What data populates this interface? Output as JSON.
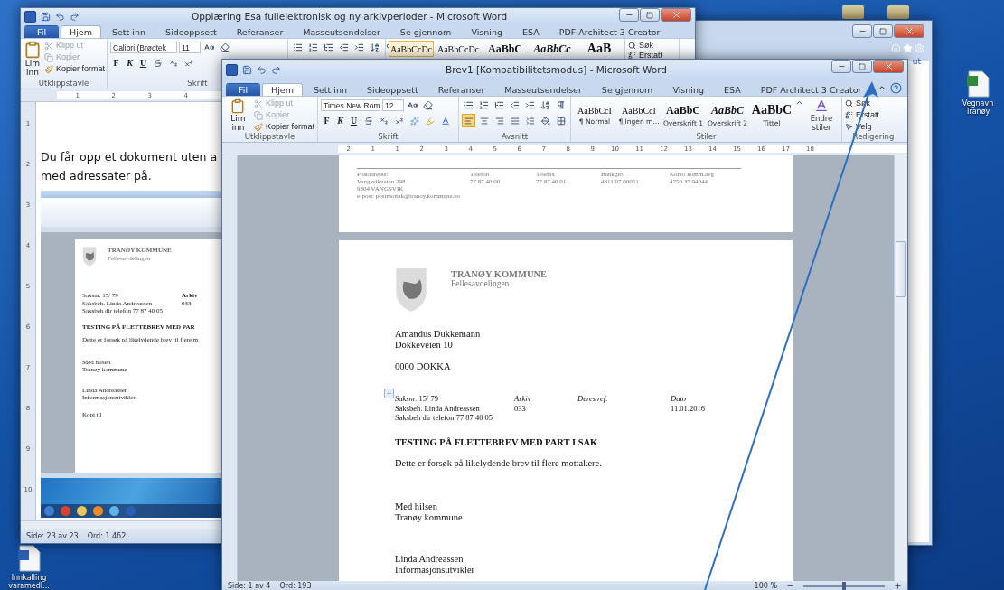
{
  "third_window": {
    "link_text": "ut"
  },
  "desktop_icons": [
    {
      "label": "Vegnavn Tranøy",
      "kind": "excel"
    },
    {
      "label": "Innkalling varamedl...",
      "kind": "word"
    }
  ],
  "back_window": {
    "title": "Opplæring Esa fullelektronisk og ny arkivperioder - Microsoft Word",
    "tabs": [
      {
        "label": "Fil",
        "kind": "file",
        "selected": false
      },
      {
        "label": "Hjem",
        "kind": "tab",
        "selected": true
      },
      {
        "label": "Sett inn",
        "kind": "tab",
        "selected": false
      },
      {
        "label": "Sideoppsett",
        "kind": "tab",
        "selected": false
      },
      {
        "label": "Referanser",
        "kind": "tab",
        "selected": false
      },
      {
        "label": "Masseutsendelser",
        "kind": "tab",
        "selected": false
      },
      {
        "label": "Se gjennom",
        "kind": "tab",
        "selected": false
      },
      {
        "label": "Visning",
        "kind": "tab",
        "selected": false
      },
      {
        "label": "ESA",
        "kind": "tab",
        "selected": false
      },
      {
        "label": "PDF Architect 3 Creator",
        "kind": "tab",
        "selected": false
      }
    ],
    "clipboard": {
      "paste": "Lim inn",
      "group": "Utklippstavle",
      "commands": [
        {
          "label": "Klipp ut",
          "kind": "cut",
          "disabled": true
        },
        {
          "label": "Kopier",
          "kind": "copy",
          "disabled": true
        },
        {
          "label": "Kopier format",
          "kind": "painter",
          "disabled": false
        }
      ]
    },
    "font": {
      "name": "Calibri (Brødtek",
      "size": "11",
      "group": "Skrift",
      "format_buttons": [
        "F",
        "K",
        "U"
      ]
    },
    "styles": [
      {
        "preview": "AaBbCcDc",
        "kind": "normal",
        "selected": true
      },
      {
        "preview": "AaBbCcDc",
        "kind": "normal",
        "selected": false
      },
      {
        "preview": "AaBbC",
        "kind": "heading1",
        "selected": false
      },
      {
        "preview": "AaBbCc",
        "kind": "heading2",
        "selected": false
      },
      {
        "preview": "AaB",
        "kind": "title",
        "selected": false
      }
    ],
    "editing": [
      "Søk",
      "Erstatt"
    ],
    "ruler": [
      "1",
      "2",
      "3",
      "4"
    ],
    "vertical_ruler": [
      "1",
      "2",
      "3",
      "4",
      "5",
      "6",
      "7",
      "8",
      "9",
      "10"
    ],
    "document": [
      "Du får opp et dokument uten a",
      "med adressater på."
    ],
    "status": [
      "Side: 23 av 23",
      "Ord: 1 462"
    ]
  },
  "embedded_screenshot": {
    "letterhead": [
      "TRANØY KOMMUNE",
      "Fellesavdelingen"
    ],
    "reference": [
      "Saksnr. 15/ 79",
      "Saksbeh. Linda Andreassen",
      "Saksbeh dir telefon 77 87 40 05"
    ],
    "archive": [
      "Arkiv",
      "033"
    ],
    "heading": "TESTING PÅ FLETTEBREV MED PAR",
    "body": "Dette er forsøk på likelydende brev til flere m",
    "closing": [
      "Med hilsen",
      "Tranøy kommune"
    ],
    "signature": [
      "Linda Andreassen",
      "Informasjonsutvikler"
    ],
    "copy": "Kopi til"
  },
  "front_window": {
    "title": "Brev1 [Kompatibilitetsmodus] - Microsoft Word",
    "tabs": [
      {
        "label": "Fil",
        "kind": "file",
        "selected": false
      },
      {
        "label": "Hjem",
        "kind": "tab",
        "selected": true
      },
      {
        "label": "Sett inn",
        "kind": "tab",
        "selected": false
      },
      {
        "label": "Sideoppsett",
        "kind": "tab",
        "selected": false
      },
      {
        "label": "Referanser",
        "kind": "tab",
        "selected": false
      },
      {
        "label": "Masseutsendelser",
        "kind": "tab",
        "selected": false
      },
      {
        "label": "Se gjennom",
        "kind": "tab",
        "selected": false
      },
      {
        "label": "Visning",
        "kind": "tab",
        "selected": false
      },
      {
        "label": "ESA",
        "kind": "tab",
        "selected": false
      },
      {
        "label": "PDF Architect 3 Creator",
        "kind": "tab",
        "selected": false
      }
    ],
    "clipboard": {
      "paste": "Lim inn",
      "group": "Utklippstavle",
      "commands": [
        {
          "label": "Klipp ut",
          "kind": "cut",
          "disabled": true
        },
        {
          "label": "Kopier",
          "kind": "copy",
          "disabled": true
        },
        {
          "label": "Kopier format",
          "kind": "painter",
          "disabled": false
        }
      ]
    },
    "font": {
      "name": "Times New Rom",
      "size": "12",
      "group": "Skrift",
      "format_buttons": [
        "F",
        "K",
        "U"
      ]
    },
    "paragraph": {
      "group": "Avsnitt",
      "alignments": [
        {
          "kind": "left",
          "selected": true
        },
        {
          "kind": "center",
          "selected": false
        },
        {
          "kind": "right",
          "selected": false
        },
        {
          "kind": "justify",
          "selected": false
        }
      ]
    },
    "styles": {
      "group": "Stiler",
      "change": "Endre stiler",
      "items": [
        {
          "preview": "AaBbCcI",
          "label": "¶ Normal",
          "kind": "normal"
        },
        {
          "preview": "AaBbCcI",
          "label": "¶ Ingen m...",
          "kind": "normal"
        },
        {
          "preview": "AaBbC",
          "label": "Overskrift 1",
          "kind": "heading1"
        },
        {
          "preview": "AaBbC",
          "label": "Overskrift 2",
          "kind": "heading2"
        },
        {
          "preview": "AaBbC",
          "label": "Tittel",
          "kind": "title"
        }
      ]
    },
    "editing": {
      "group": "Redigering",
      "commands": [
        {
          "label": "Søk",
          "kind": "find"
        },
        {
          "label": "Erstatt",
          "kind": "replace"
        },
        {
          "label": "Velg",
          "kind": "select"
        }
      ]
    },
    "ruler": [
      "2",
      "1",
      "1",
      "2",
      "3",
      "4",
      "5",
      "6",
      "7",
      "8",
      "9",
      "10",
      "11",
      "12",
      "13",
      "14",
      "15",
      "16",
      "17",
      "18"
    ],
    "footer_columns": [
      {
        "heading": "Postadresse:",
        "lines": [
          "Vangsvikveien 298",
          "9304 VANGSVIK",
          "e-post: postmottak@tranoy.kommune.no"
        ]
      },
      {
        "heading": "Telefon",
        "lines": [
          "77 87 40 00"
        ]
      },
      {
        "heading": "Telefax",
        "lines": [
          "77 87 40 01"
        ]
      },
      {
        "heading": "Bankgiro",
        "lines": [
          "4811.07.00051"
        ]
      },
      {
        "heading": "Konto komm.avg",
        "lines": [
          "4750.35.94044"
        ]
      }
    ],
    "letter": {
      "letterhead": [
        "TRANØY KOMMUNE",
        "Fellesavdelingen"
      ],
      "recipient": {
        "name": "Amandus Dukkemann",
        "street": "Dokkeveien 10",
        "postal": "0000 DOKKA"
      },
      "reference": [
        {
          "heading": "*Saksnr.* 15/ 79",
          "lines": [
            "Saksbeh. Linda Andreassen",
            "Saksbeh dir telefon 77 87 40 05"
          ]
        },
        {
          "heading": "*Arkiv*",
          "lines": [
            "033"
          ]
        },
        {
          "heading": "*Deres ref.*"
        },
        {
          "heading": "*Dato*",
          "lines": [
            "11.01.2016"
          ]
        }
      ],
      "heading": "TESTING PÅ FLETTEBREV MED PART I SAK",
      "body": "Dette er forsøk på likelydende brev til flere mottakere.",
      "closing": [
        "Med hilsen",
        "Tranøy kommune"
      ],
      "signature": [
        "Linda Andreassen",
        "Informasjonsutvikler"
      ]
    },
    "status": {
      "page": "Side: 1 av 4",
      "words": "Ord: 193",
      "zoom": "100 %",
      "level": 0.5
    }
  }
}
